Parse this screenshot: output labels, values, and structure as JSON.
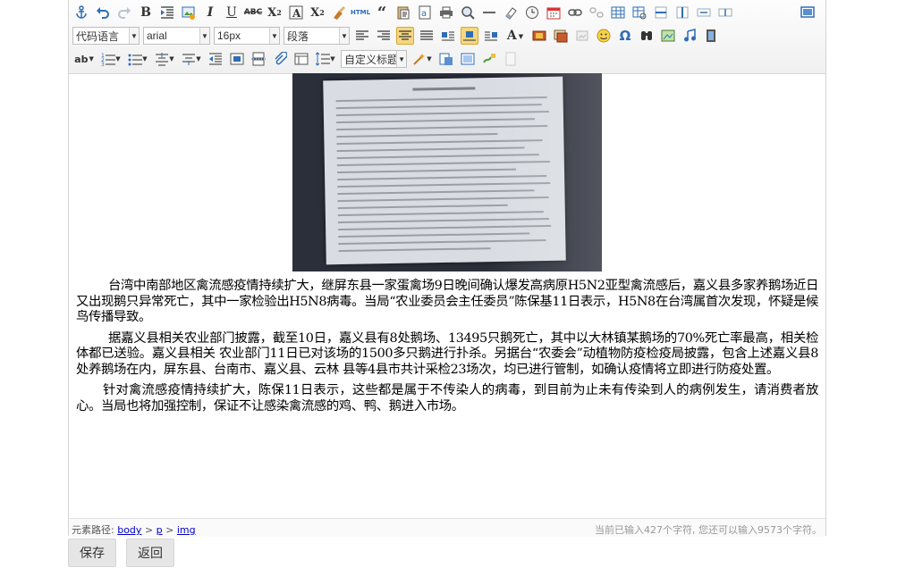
{
  "toolbar": {
    "row1_icons": [
      "anchor-icon",
      "undo-icon",
      "redo-icon",
      "bold-icon",
      "indent-icon",
      "insert-image-icon",
      "italic-icon",
      "underline-icon",
      "strikethrough-icon",
      "subscript-icon",
      "format-match-icon",
      "superscript-icon",
      "eraser-icon",
      "html-icon",
      "blockquote-icon",
      "paste-text-icon",
      "selectall-icon",
      "print-icon",
      "preview-icon",
      "horizontal-rule-icon",
      "remove-format-icon",
      "time-icon",
      "date-icon",
      "link-icon",
      "unlink-icon",
      "table-icon",
      "table-props-icon",
      "insert-row-icon",
      "insert-col-icon",
      "merge-cells-icon",
      "split-cells-icon"
    ],
    "html_label": "HTML",
    "font_code": "代码语言",
    "font_family": "arial",
    "font_size": "16px",
    "paragraph": "段落",
    "custom_title": "自定义标题",
    "omega_label": "Ω"
  },
  "document": {
    "paragraphs": [
      "台湾中南部地区禽流感疫情持续扩大，继屏东县一家蛋禽场9日晚间确认爆发高病原H5N2亚型禽流感后，嘉义县多家养鹅场近日又出现鹅只异常死亡，其中一家检验出H5N8病毒。当局“农业委员会主任委员”陈保基11日表示，H5N8在台湾属首次发现，怀疑是候鸟传播导致。",
      "据嘉义县相关农业部门披露，截至10日，嘉义县有8处鹅场、13495只鹅死亡，其中以大林镇某鹅场的70%死亡率最高，相关检体都已送验。嘉义县相关 农业部门11日已对该场的1500多只鹅进行扑杀。另据台“农委会”动植物防疫检疫局披露，包含上述嘉义县8处养鹅场在内，屏东县、台南市、嘉义县、云林 县等4县市共计采检23场次，均已进行管制，如确认疫情将立即进行防疫处置。",
      "针对禽流感疫情持续扩大，陈保11日表示，这些都是属于不传染人的病毒，到目前为止未有传染到人的病例发生，请消费者放心。当局也将加强控制，保证不让感染禽流感的鸡、鸭、鹅进入市场。"
    ]
  },
  "status": {
    "path_label": "元素路径:",
    "path_items": [
      "body",
      "p",
      "img"
    ],
    "separator": ">",
    "count_text": "当前已输入427个字符, 您还可以输入9573个字符。"
  },
  "buttons": {
    "save": "保存",
    "back": "返回"
  }
}
